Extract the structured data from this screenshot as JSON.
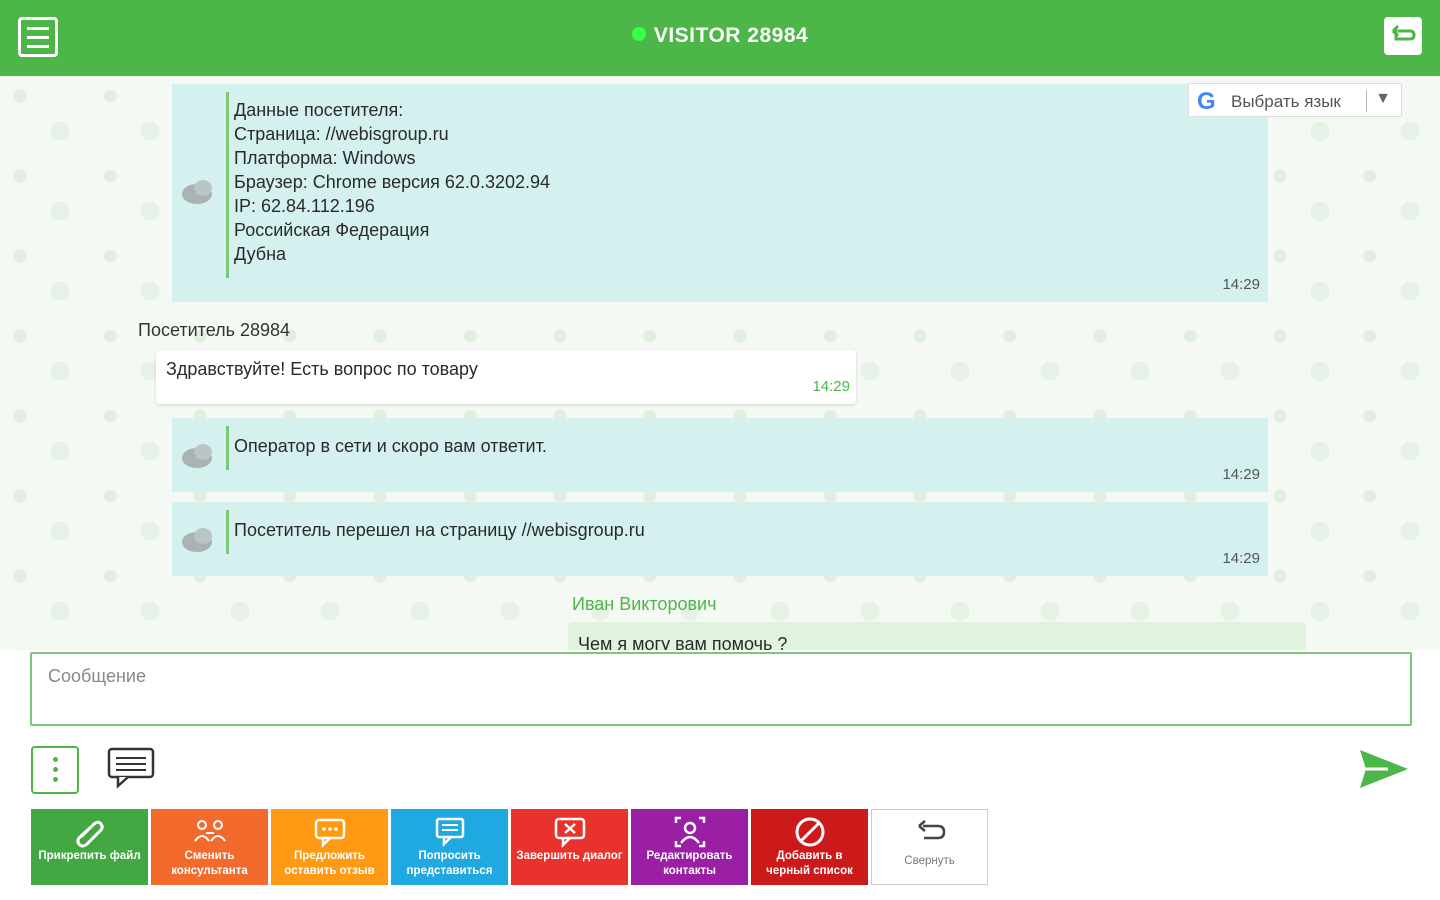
{
  "header": {
    "title": "VISITOR 28984",
    "status_color": "#39ff45"
  },
  "language": {
    "label": "Выбрать язык",
    "logo": "G"
  },
  "messages": {
    "visitor_info": {
      "lines": [
        "Данные посетителя:",
        "Страница: //webisgroup.ru",
        "Платформа: Windows",
        "Браузер: Chrome версия 62.0.3202.94",
        "IP: 62.84.112.196",
        "Российская Федерация",
        "Дубна"
      ],
      "time": "14:29"
    },
    "visitor_name": "Посетитель 28984",
    "visitor_message": {
      "text": "Здравствуйте! Есть вопрос по товару",
      "time": "14:29"
    },
    "system_online": {
      "text": "Оператор в сети и скоро вам ответит.",
      "time": "14:29"
    },
    "system_page": {
      "text": "Посетитель перешел на страницу //webisgroup.ru",
      "time": "14:29"
    },
    "operator_name": "Иван Викторович",
    "operator_message": {
      "text": "Чем я могу вам помочь ?"
    }
  },
  "input": {
    "placeholder": "Сообщение"
  },
  "actions": [
    {
      "label": "Прикрепить файл",
      "icon": "paperclip-icon",
      "color": "#43a843"
    },
    {
      "label": "Сменить консультанта",
      "icon": "change-consultant-icon",
      "color": "#f26a2c"
    },
    {
      "label": "Предложить оставить отзыв",
      "icon": "review-icon",
      "color": "#ff9a12"
    },
    {
      "label": "Попросить представиться",
      "icon": "introduce-icon",
      "color": "#20a8e0"
    },
    {
      "label": "Завершить диалог",
      "icon": "close-dialog-icon",
      "color": "#e8322b"
    },
    {
      "label": "Редактировать контакты",
      "icon": "edit-contacts-icon",
      "color": "#9b1fa4"
    },
    {
      "label": "Добавить в черный список",
      "icon": "block-icon",
      "color": "#cc1a1a"
    },
    {
      "label": "Свернуть",
      "icon": "collapse-icon",
      "color": "#ffffff"
    }
  ]
}
